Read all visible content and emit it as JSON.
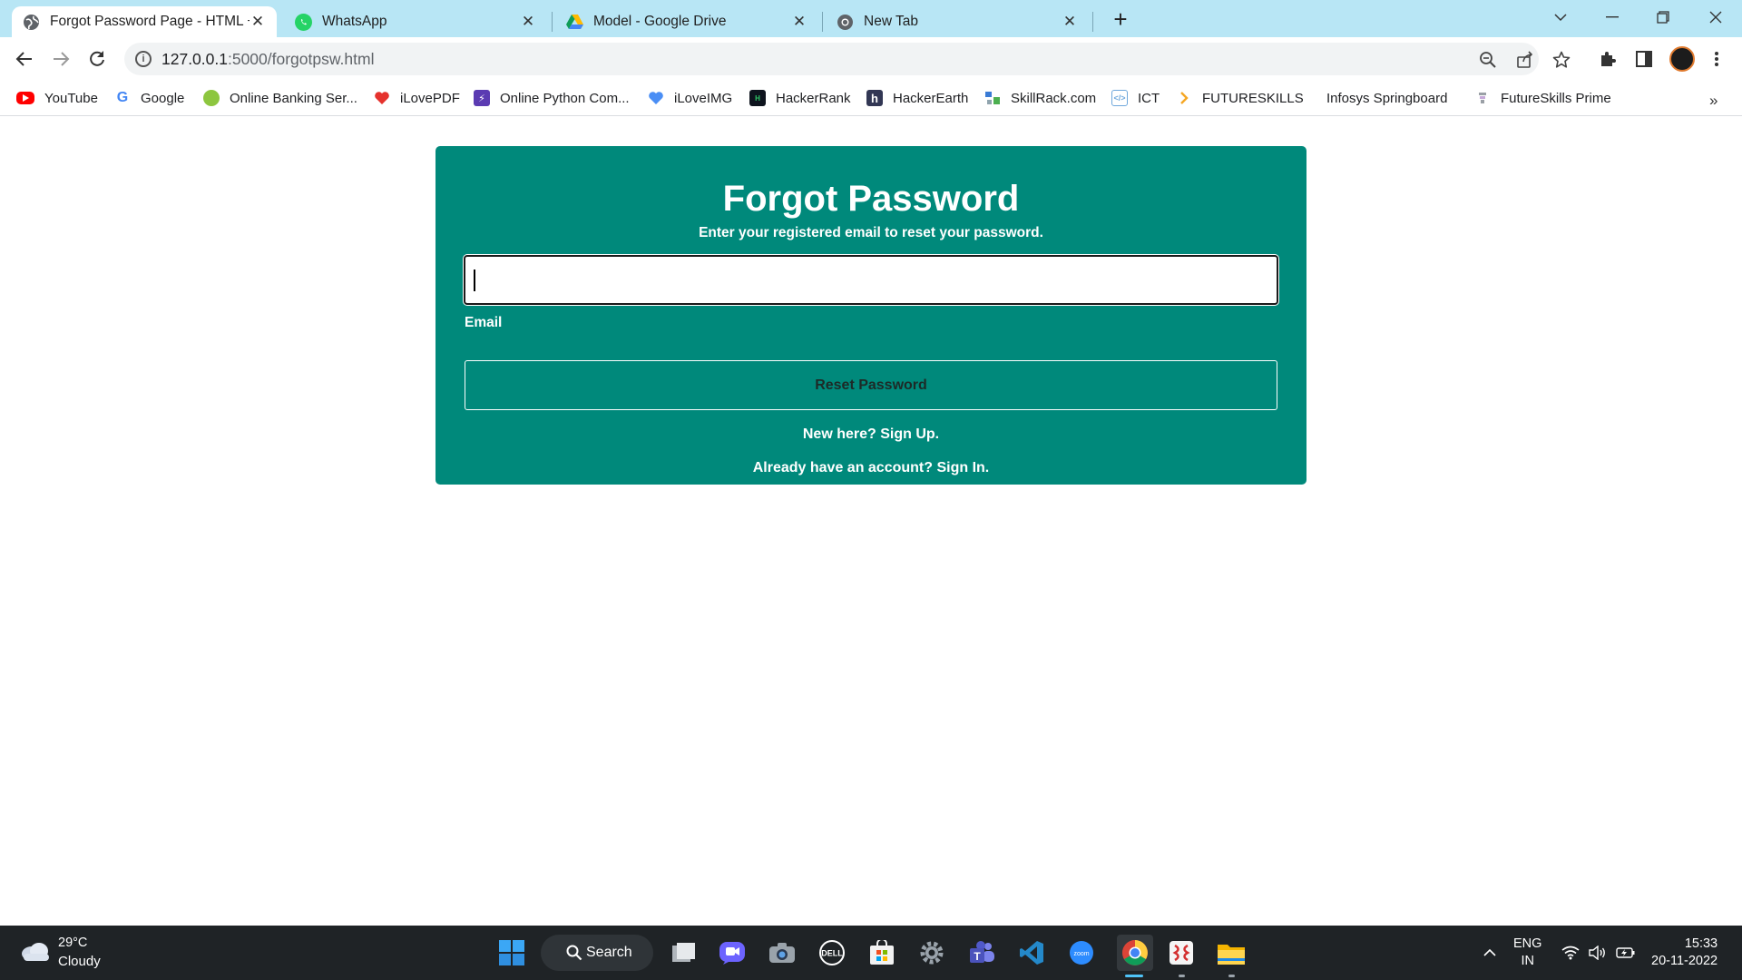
{
  "browser": {
    "tabs": [
      {
        "title": "Forgot Password Page - HTML +",
        "active": true,
        "icon": "globe-icon"
      },
      {
        "title": "WhatsApp",
        "active": false,
        "icon": "whatsapp-icon"
      },
      {
        "title": "Model - Google Drive",
        "active": false,
        "icon": "google-drive-icon"
      },
      {
        "title": "New Tab",
        "active": false,
        "icon": "chrome-icon"
      }
    ],
    "address": {
      "host": "127.0.0.1",
      "rest": ":5000/forgotpsw.html"
    },
    "bookmarks": [
      {
        "label": "YouTube",
        "icon": "youtube-icon",
        "color": "#ff0000"
      },
      {
        "label": "Google",
        "icon": "google-icon",
        "color": "#4285f4"
      },
      {
        "label": "Online Banking Ser...",
        "icon": "bank-icon",
        "color": "#8dc63f"
      },
      {
        "label": "iLovePDF",
        "icon": "heart-icon",
        "color": "#e5322d"
      },
      {
        "label": "Online Python Com...",
        "icon": "bolt-icon",
        "color": "#5b3bb2"
      },
      {
        "label": "iLoveIMG",
        "icon": "heart-icon",
        "color": "#4a8ef5"
      },
      {
        "label": "HackerRank",
        "icon": "hackerrank-icon",
        "color": "#0e141e"
      },
      {
        "label": "HackerEarth",
        "icon": "hackerearth-icon",
        "color": "#323754"
      },
      {
        "label": "SkillRack.com",
        "icon": "skillrack-icon",
        "color": "#3a7bd5"
      },
      {
        "label": "ICT",
        "icon": "ict-icon",
        "color": "#6fa8dc"
      },
      {
        "label": "FUTURESKILLS",
        "icon": "chevron-right-icon",
        "color": "#f5a623"
      },
      {
        "label": "Infosys Springboard",
        "icon": "springboard-icon",
        "color": "#ffffff"
      },
      {
        "label": "FutureSkills Prime",
        "icon": "futureskills-icon",
        "color": "#9aa0a6"
      }
    ]
  },
  "page": {
    "title": "Forgot Password",
    "subtitle": "Enter your registered email to reset your password.",
    "email_value": "",
    "email_label": "Email",
    "reset_button": "Reset Password",
    "signup_link": "New here? Sign Up.",
    "signin_link": "Already have an account? Sign In.",
    "accent": "#00897b"
  },
  "taskbar": {
    "weather_temp": "29°C",
    "weather_desc": "Cloudy",
    "search_label": "Search",
    "lang_top": "ENG",
    "lang_bottom": "IN",
    "time": "15:33",
    "date": "20-11-2022"
  }
}
